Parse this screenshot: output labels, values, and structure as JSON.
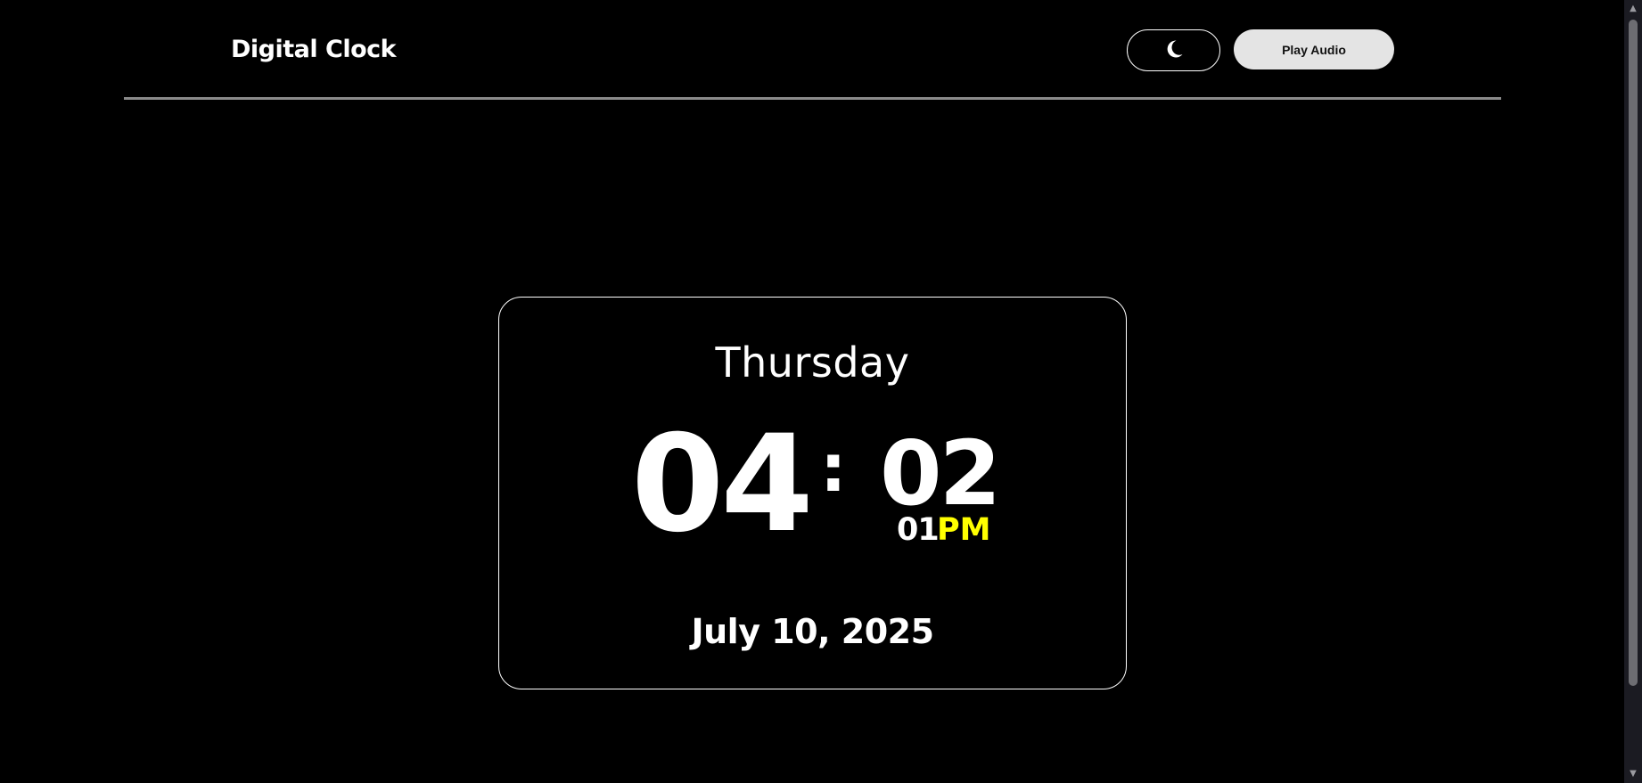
{
  "header": {
    "title": "Digital Clock",
    "theme_icon": "moon-icon",
    "play_audio_label": "Play Audio"
  },
  "clock": {
    "day": "Thursday",
    "hours": "04",
    "separator": ":",
    "minutes": "02",
    "seconds": "01",
    "period": "PM",
    "date": "July 10, 2025"
  },
  "colors": {
    "background": "#000000",
    "text": "#ffffff",
    "accent_period": "#ffff00",
    "button_bg": "#e4e4e4"
  }
}
